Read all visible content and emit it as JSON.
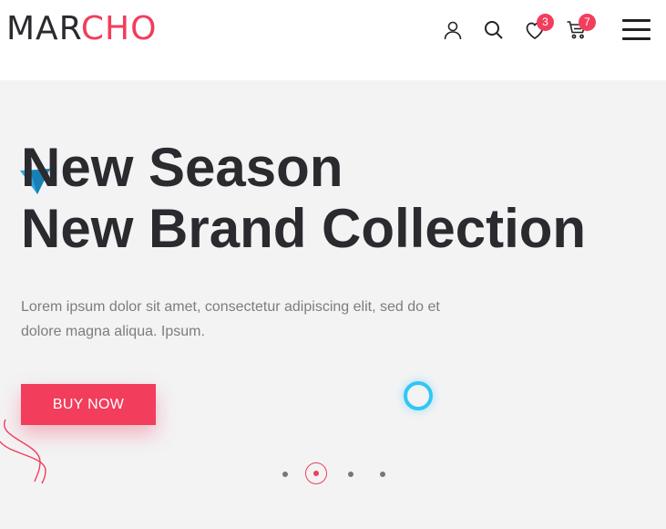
{
  "brand": {
    "part1": "MAR",
    "part2": "CHO"
  },
  "header": {
    "wishlist_count": "3",
    "cart_count": "7",
    "icons": [
      "user-icon",
      "search-icon",
      "heart-icon",
      "cart-icon",
      "menu-icon"
    ]
  },
  "hero": {
    "title_line1": "New Season",
    "title_line2": "New Brand Collection",
    "description": "Lorem ipsum dolor sit amet, consectetur adipiscing elit, sed do et dolore magna aliqua. Ipsum.",
    "button_label": "BUY NOW",
    "slides": {
      "count": 4,
      "active": 2
    }
  },
  "colors": {
    "accent": "#f23d5c",
    "dark": "#2a2a2f",
    "hero_bg": "#f3f3f4",
    "ring": "#31c6f5"
  }
}
